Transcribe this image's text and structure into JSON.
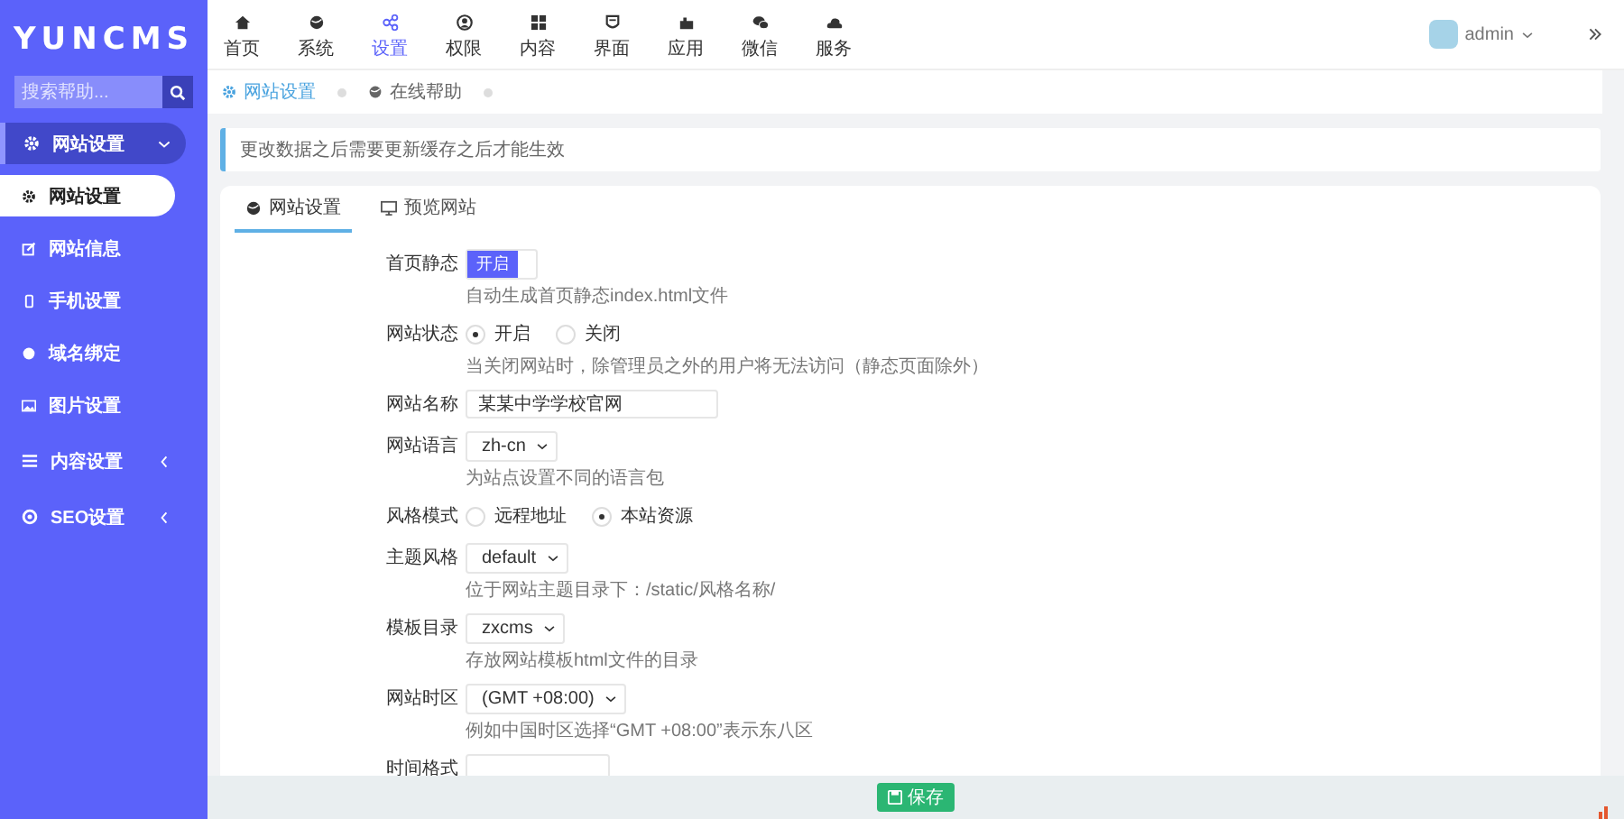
{
  "logo": "YUNCMS",
  "search": {
    "placeholder": "搜索帮助..."
  },
  "sidebar": {
    "items": [
      {
        "label": "网站设置",
        "selected": true,
        "expanded": true,
        "children": [
          {
            "label": "网站设置",
            "selected": true
          },
          {
            "label": "网站信息",
            "selected": false
          },
          {
            "label": "手机设置",
            "selected": false
          },
          {
            "label": "域名绑定",
            "selected": false
          },
          {
            "label": "图片设置",
            "selected": false
          }
        ]
      },
      {
        "label": "内容设置",
        "selected": false,
        "expanded": false
      },
      {
        "label": "SEO设置",
        "selected": false,
        "expanded": false
      }
    ]
  },
  "topnav": [
    {
      "label": "首页",
      "selected": false
    },
    {
      "label": "系统",
      "selected": false
    },
    {
      "label": "设置",
      "selected": true
    },
    {
      "label": "权限",
      "selected": false
    },
    {
      "label": "内容",
      "selected": false
    },
    {
      "label": "界面",
      "selected": false
    },
    {
      "label": "应用",
      "selected": false
    },
    {
      "label": "微信",
      "selected": false
    },
    {
      "label": "服务",
      "selected": false
    }
  ],
  "user": {
    "name": "admin"
  },
  "breadcrumb": [
    {
      "label": "网站设置",
      "selected": true
    },
    {
      "label": "在线帮助",
      "selected": false
    }
  ],
  "notice": "更改数据之后需要更新缓存之后才能生效",
  "card_tabs": [
    {
      "label": "网站设置",
      "selected": true
    },
    {
      "label": "预览网站",
      "selected": false
    }
  ],
  "fields": [
    {
      "kind": "toggle",
      "label": "首页静态",
      "on": true,
      "text": "开启",
      "hint": "自动生成首页静态index.html文件"
    },
    {
      "kind": "radio",
      "label": "网站状态",
      "options": [
        {
          "label": "开启",
          "selected": true
        },
        {
          "label": "关闭",
          "selected": false
        }
      ],
      "hint": "当关闭网站时，除管理员之外的用户将无法访问（静态页面除外）"
    },
    {
      "kind": "text",
      "label": "网站名称",
      "value": "某某中学学校官网"
    },
    {
      "kind": "select",
      "label": "网站语言",
      "value": "zh-cn",
      "hint": "为站点设置不同的语言包"
    },
    {
      "kind": "radio",
      "label": "风格模式",
      "options": [
        {
          "label": "远程地址",
          "selected": false
        },
        {
          "label": "本站资源",
          "selected": true
        }
      ]
    },
    {
      "kind": "select",
      "label": "主题风格",
      "value": "default",
      "hint": "位于网站主题目录下：/static/风格名称/"
    },
    {
      "kind": "select",
      "label": "模板目录",
      "value": "zxcms",
      "hint": "存放网站模板html文件的目录"
    },
    {
      "kind": "select",
      "label": "网站时区",
      "value": "(GMT +08:00)",
      "hint": "例如中国时区选择“GMT +08:00”表示东八区"
    },
    {
      "kind": "text",
      "label": "时间格式"
    }
  ],
  "save_button": "保存"
}
